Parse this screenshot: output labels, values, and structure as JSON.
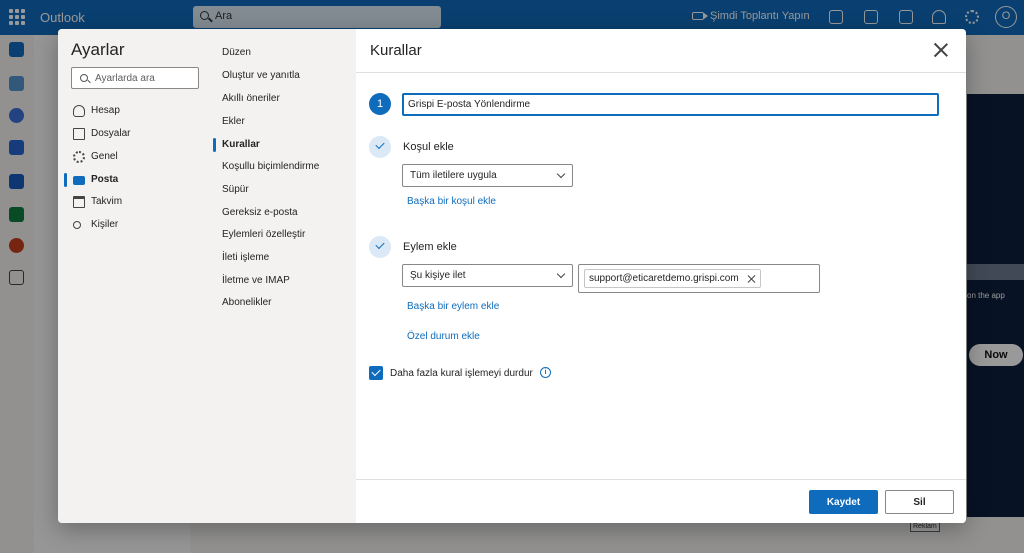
{
  "topbar": {
    "app_title": "Outlook",
    "search_placeholder": "Ara",
    "meet_now": "Şimdi Toplantı Yapın",
    "avatar_initial": "O"
  },
  "background": {
    "ad_text": "on the app",
    "now_button": "Now",
    "ad_label": "Reklam"
  },
  "settings": {
    "title": "Ayarlar",
    "search_placeholder": "Ayarlarda ara",
    "categories": [
      {
        "label": "Hesap",
        "icon": "person-icon"
      },
      {
        "label": "Dosyalar",
        "icon": "file-icon"
      },
      {
        "label": "Genel",
        "icon": "gear-icon"
      },
      {
        "label": "Posta",
        "icon": "mail-icon",
        "active": true
      },
      {
        "label": "Takvim",
        "icon": "calendar-icon"
      },
      {
        "label": "Kişiler",
        "icon": "people-icon"
      }
    ],
    "subcategories": [
      "Düzen",
      "Oluştur ve yanıtla",
      "Akıllı öneriler",
      "Ekler",
      "Kurallar",
      "Koşullu biçimlendirme",
      "Süpür",
      "Gereksiz e-posta",
      "Eylemleri özelleştir",
      "İleti işleme",
      "İletme ve IMAP",
      "Abonelikler"
    ],
    "active_subcategory": "Kurallar"
  },
  "rules": {
    "title": "Kurallar",
    "step_number": "1",
    "rule_name": "Grispi E-posta Yönlendirme",
    "condition": {
      "title": "Koşul ekle",
      "selected": "Tüm iletilere uygula",
      "add_link": "Başka bir koşul ekle"
    },
    "action": {
      "title": "Eylem ekle",
      "selected": "Şu kişiye ilet",
      "recipient": "support@eticaretdemo.grispi.com",
      "add_link": "Başka bir eylem ekle",
      "exception_link": "Özel durum ekle"
    },
    "stop_processing": {
      "label": "Daha fazla kural işlemeyi durdur",
      "checked": true
    },
    "save_label": "Kaydet",
    "delete_label": "Sil"
  },
  "colors": {
    "accent": "#0f6cbd",
    "topbar": "#0f6cbd"
  }
}
